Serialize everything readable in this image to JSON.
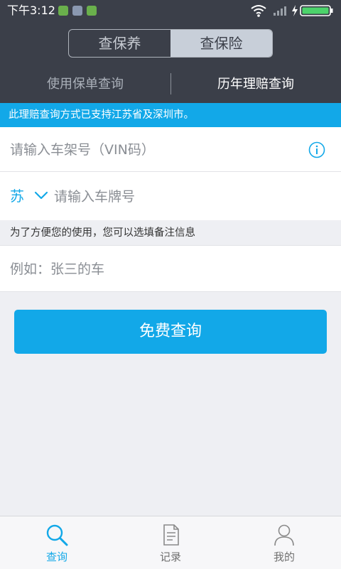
{
  "status_bar": {
    "time": "下午3:12"
  },
  "header": {
    "segments": [
      {
        "label": "查保养",
        "active": false
      },
      {
        "label": "查保险",
        "active": true
      }
    ],
    "subtabs": [
      {
        "label": "使用保单查询",
        "active": false
      },
      {
        "label": "历年理赔查询",
        "active": true
      }
    ]
  },
  "banner": {
    "text": "此理赔查询方式已支持江苏省及深圳市。"
  },
  "form": {
    "vin_placeholder": "请输入车架号（VIN码）",
    "vin_value": "",
    "province": "苏",
    "plate_placeholder": "请输入车牌号",
    "plate_value": "",
    "note_label": "为了方便您的使用，您可以选填备注信息",
    "note_placeholder": "例如：张三的车",
    "note_value": "",
    "submit_label": "免费查询"
  },
  "tabbar": {
    "items": [
      {
        "label": "查询",
        "icon": "search-icon",
        "active": true
      },
      {
        "label": "记录",
        "icon": "document-icon",
        "active": false
      },
      {
        "label": "我的",
        "icon": "person-icon",
        "active": false
      }
    ]
  },
  "colors": {
    "accent": "#12a8e8",
    "header_bg": "#3b3f49",
    "page_bg": "#eeeff3"
  }
}
